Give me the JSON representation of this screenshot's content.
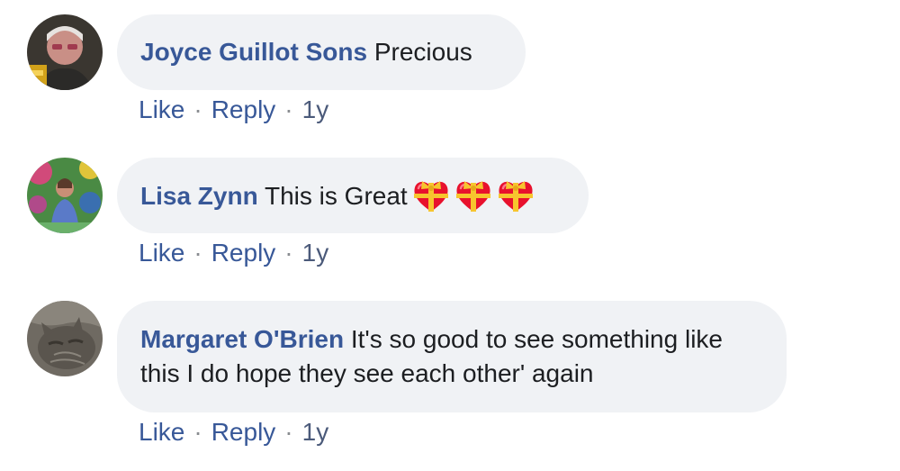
{
  "comments": [
    {
      "author": "Joyce Guillot Sons",
      "text": "Precious",
      "actions": {
        "like": "Like",
        "reply": "Reply",
        "time": "1y"
      }
    },
    {
      "author": "Lisa Zynn",
      "text": "This is Great",
      "emoji": [
        "heart-with-ribbon-icon",
        "heart-with-ribbon-icon",
        "heart-with-ribbon-icon"
      ],
      "actions": {
        "like": "Like",
        "reply": "Reply",
        "time": "1y"
      }
    },
    {
      "author": "Margaret O'Brien",
      "text": "It's so good to see something like this I do hope they see each other' again",
      "actions": {
        "like": "Like",
        "reply": "Reply",
        "time": "1y"
      }
    }
  ],
  "colors": {
    "author_link": "#385898",
    "bubble_bg": "#f0f2f5",
    "body_text": "#1c1e21"
  }
}
